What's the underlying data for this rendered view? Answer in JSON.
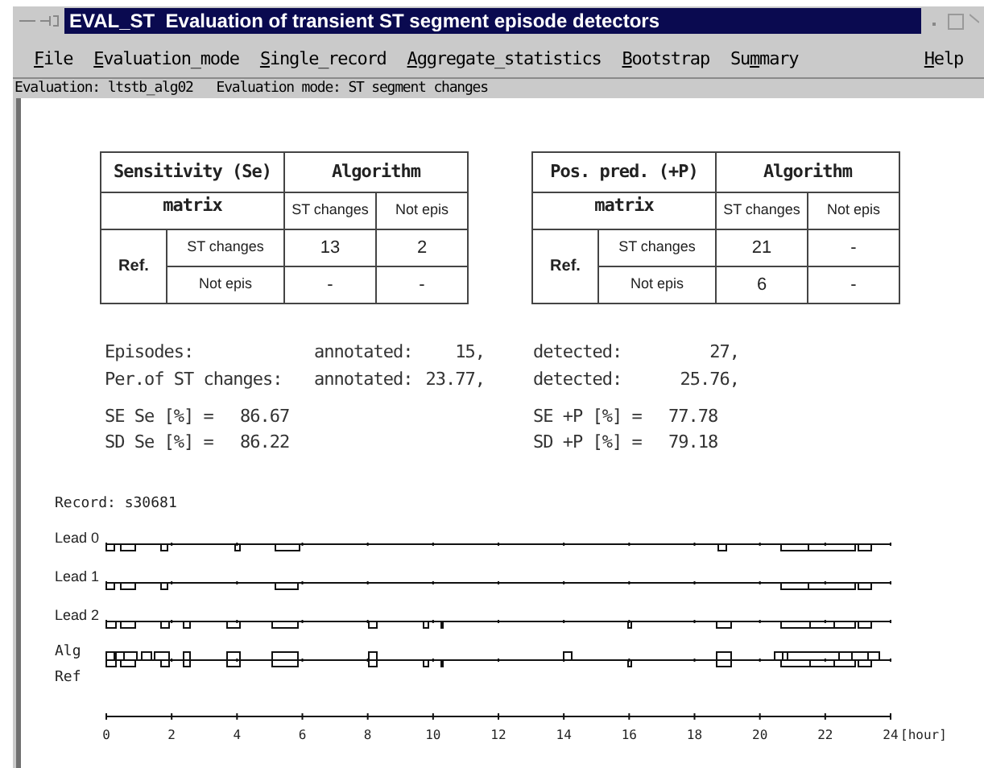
{
  "window": {
    "title": "EVAL_ST  Evaluation of transient ST segment episode detectors"
  },
  "menu": [
    {
      "accel": "F",
      "after": "ile"
    },
    {
      "accel": "E",
      "after": "valuation_mode"
    },
    {
      "accel": "S",
      "after": "ingle_record"
    },
    {
      "accel": "A",
      "after": "ggregate_statistics"
    },
    {
      "accel": "B",
      "after": "ootstrap"
    },
    {
      "before": "Su",
      "accel": "m",
      "after": "mary"
    }
  ],
  "help_menu": {
    "accel": "H",
    "after": "elp"
  },
  "status_line": "Evaluation: ltstb_alg02   Evaluation mode: ST segment changes",
  "matrices": [
    {
      "title": "Sensitivity (Se)",
      "subtitle": "matrix",
      "header": "Algorithm",
      "columns": [
        "ST changes",
        "Not epis"
      ],
      "row_header": "Ref.",
      "rows": [
        {
          "label": "ST changes",
          "values": [
            "13",
            "2"
          ]
        },
        {
          "label": "Not epis",
          "values": [
            "-",
            "-"
          ]
        }
      ]
    },
    {
      "title": "Pos. pred. (+P)",
      "subtitle": "matrix",
      "header": "Algorithm",
      "columns": [
        "ST changes",
        "Not epis"
      ],
      "row_header": "Ref.",
      "rows": [
        {
          "label": "ST changes",
          "values": [
            "21",
            "-"
          ]
        },
        {
          "label": "Not epis",
          "values": [
            "6",
            "-"
          ]
        }
      ]
    }
  ],
  "stats": [
    {
      "label": "Episodes:",
      "annotated_label": "annotated:",
      "annotated": "15,",
      "detected_label": "detected:",
      "detected": "27,"
    },
    {
      "label": "Per.of ST changes:",
      "annotated_label": "annotated:",
      "annotated": "23.77,",
      "detected_label": "detected:",
      "detected": "25.76,"
    }
  ],
  "scores": [
    {
      "se_label": "SE Se [%] =",
      "se": "86.67",
      "p_label": "SE +P [%] =",
      "p": "77.78"
    },
    {
      "se_label": "SD Se [%] =",
      "se": "86.22",
      "p_label": "SD +P [%] =",
      "p": "79.18"
    }
  ],
  "record": {
    "label": "Record: s30681",
    "leads": [
      "Lead 0",
      "Lead 1",
      "Lead 2"
    ],
    "alg_label": "Alg",
    "ref_label": "Ref",
    "axis": {
      "ticks": [
        "0",
        "2",
        "4",
        "6",
        "8",
        "10",
        "12",
        "14",
        "16",
        "18",
        "20",
        "22",
        "24"
      ],
      "unit": "[hour]"
    }
  }
}
